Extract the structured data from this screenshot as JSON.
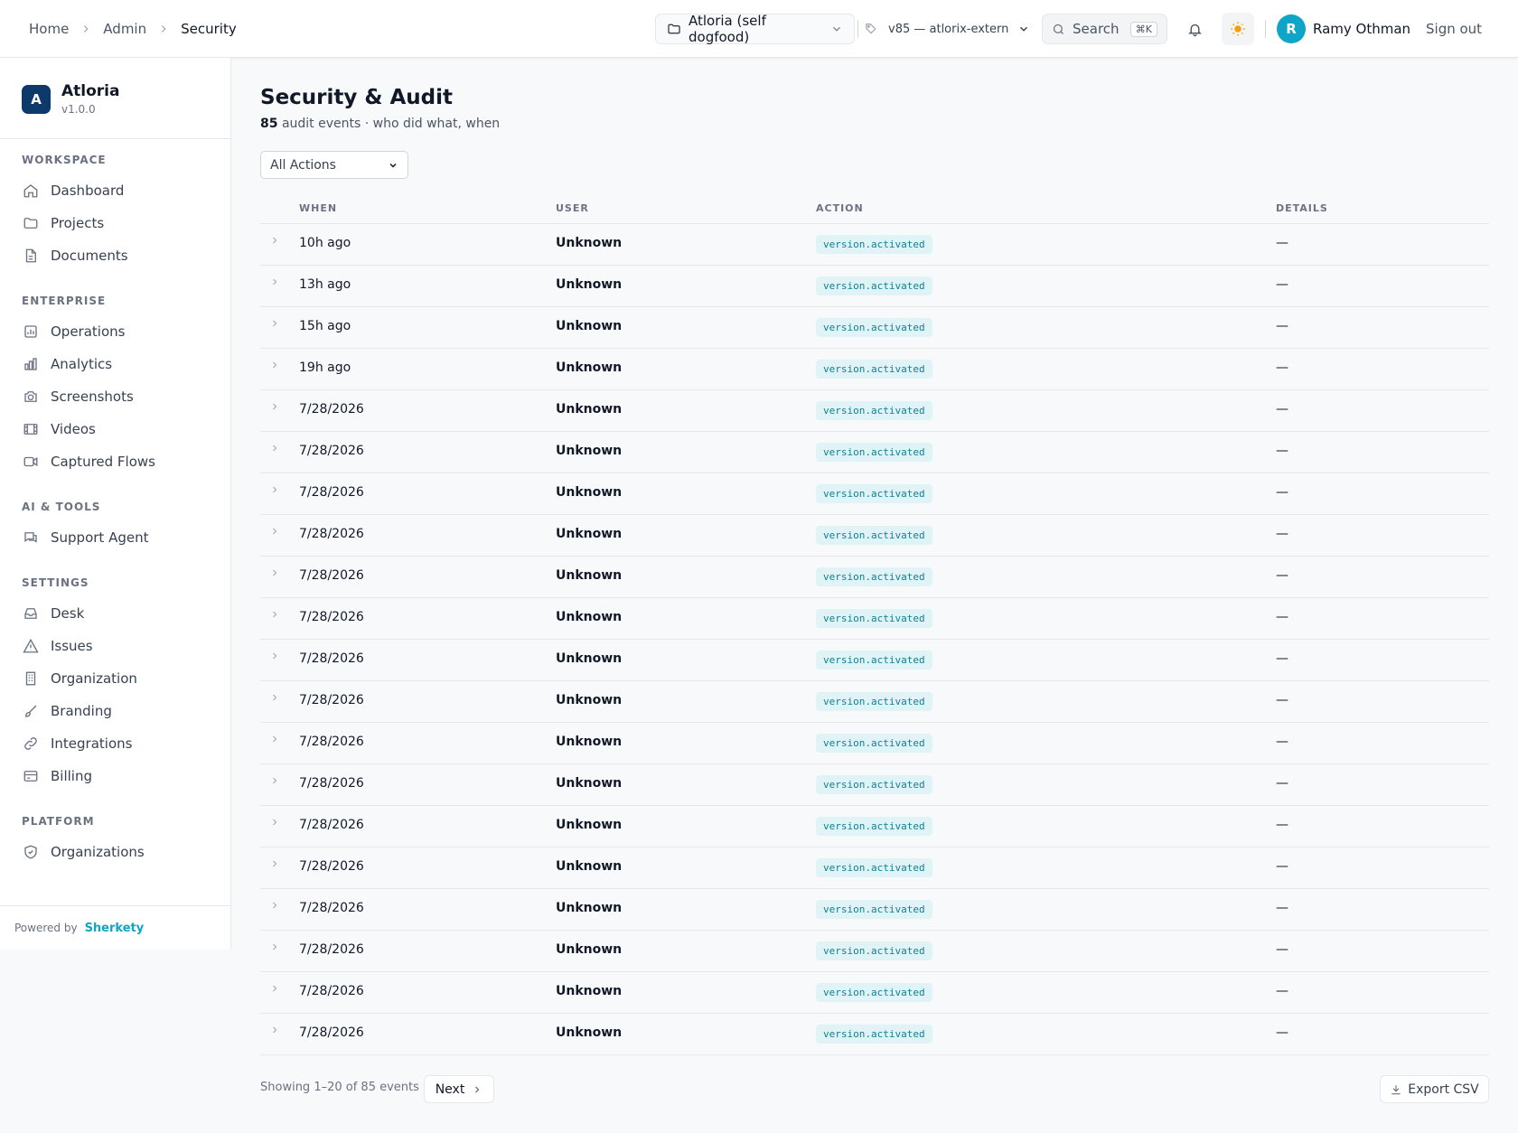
{
  "breadcrumb": {
    "home": "Home",
    "admin": "Admin",
    "current": "Security"
  },
  "header": {
    "project": "Atloria (self dogfood)",
    "version": "v85 — atlorix-extern",
    "search_label": "Search",
    "search_shortcut": "⌘K",
    "user_initial": "R",
    "user_name": "Ramy Othman",
    "sign_out": "Sign out"
  },
  "brand": {
    "logo_letter": "A",
    "name": "Atloria",
    "version": "v1.0.0"
  },
  "sidebar": {
    "sections": {
      "workspace": "WORKSPACE",
      "enterprise": "ENTERPRISE",
      "ai_tools": "AI & TOOLS",
      "settings": "SETTINGS",
      "platform": "PLATFORM"
    },
    "items": {
      "dashboard": "Dashboard",
      "projects": "Projects",
      "documents": "Documents",
      "operations": "Operations",
      "analytics": "Analytics",
      "screenshots": "Screenshots",
      "videos": "Videos",
      "captured_flows": "Captured Flows",
      "support_agent": "Support Agent",
      "desk": "Desk",
      "issues": "Issues",
      "organization": "Organization",
      "branding": "Branding",
      "integrations": "Integrations",
      "billing": "Billing",
      "organizations": "Organizations"
    },
    "footer": {
      "powered_by": "Powered by",
      "brand": "Sherkety"
    }
  },
  "main": {
    "title": "Security & Audit",
    "event_count": "85",
    "subtitle_rest": "audit events · who did what, when",
    "filter_value": "All Actions",
    "columns": {
      "when": "WHEN",
      "user": "USER",
      "action": "ACTION",
      "details": "DETAILS"
    },
    "rows": [
      {
        "when": "10h ago",
        "user": "Unknown",
        "action": "version.activated",
        "details": "—"
      },
      {
        "when": "13h ago",
        "user": "Unknown",
        "action": "version.activated",
        "details": "—"
      },
      {
        "when": "15h ago",
        "user": "Unknown",
        "action": "version.activated",
        "details": "—"
      },
      {
        "when": "19h ago",
        "user": "Unknown",
        "action": "version.activated",
        "details": "—"
      },
      {
        "when": "7/28/2026",
        "user": "Unknown",
        "action": "version.activated",
        "details": "—"
      },
      {
        "when": "7/28/2026",
        "user": "Unknown",
        "action": "version.activated",
        "details": "—"
      },
      {
        "when": "7/28/2026",
        "user": "Unknown",
        "action": "version.activated",
        "details": "—"
      },
      {
        "when": "7/28/2026",
        "user": "Unknown",
        "action": "version.activated",
        "details": "—"
      },
      {
        "when": "7/28/2026",
        "user": "Unknown",
        "action": "version.activated",
        "details": "—"
      },
      {
        "when": "7/28/2026",
        "user": "Unknown",
        "action": "version.activated",
        "details": "—"
      },
      {
        "when": "7/28/2026",
        "user": "Unknown",
        "action": "version.activated",
        "details": "—"
      },
      {
        "when": "7/28/2026",
        "user": "Unknown",
        "action": "version.activated",
        "details": "—"
      },
      {
        "when": "7/28/2026",
        "user": "Unknown",
        "action": "version.activated",
        "details": "—"
      },
      {
        "when": "7/28/2026",
        "user": "Unknown",
        "action": "version.activated",
        "details": "—"
      },
      {
        "when": "7/28/2026",
        "user": "Unknown",
        "action": "version.activated",
        "details": "—"
      },
      {
        "when": "7/28/2026",
        "user": "Unknown",
        "action": "version.activated",
        "details": "—"
      },
      {
        "when": "7/28/2026",
        "user": "Unknown",
        "action": "version.activated",
        "details": "—"
      },
      {
        "when": "7/28/2026",
        "user": "Unknown",
        "action": "version.activated",
        "details": "—"
      },
      {
        "when": "7/28/2026",
        "user": "Unknown",
        "action": "version.activated",
        "details": "—"
      },
      {
        "when": "7/28/2026",
        "user": "Unknown",
        "action": "version.activated",
        "details": "—"
      }
    ],
    "pager_text": "Showing 1–20 of 85 events",
    "next_label": "Next",
    "export_label": "Export CSV"
  },
  "colors": {
    "accent": "#0ea5c6",
    "brand_logo": "#0e3a6b",
    "badge_bg": "#e0f4f7",
    "badge_text": "#0f7f93",
    "sun": "#f59e0b"
  }
}
